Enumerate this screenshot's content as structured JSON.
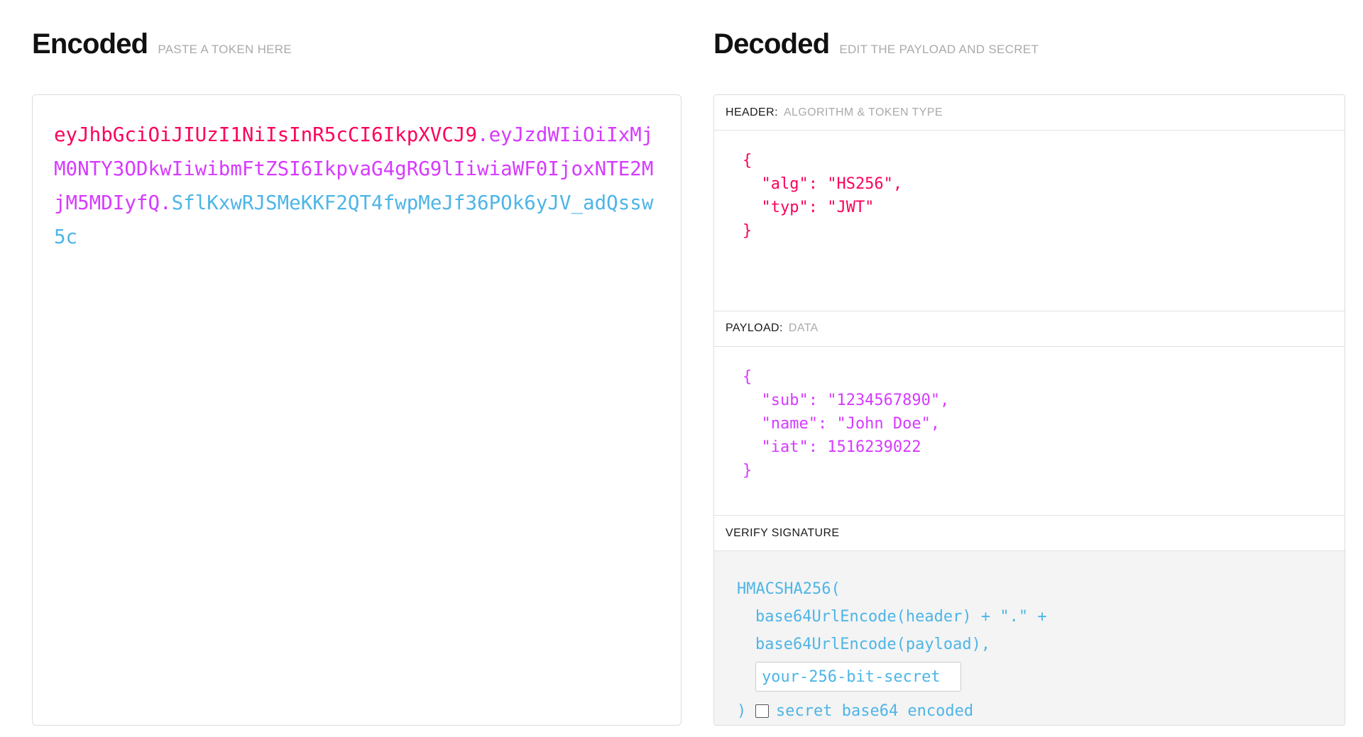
{
  "encoded": {
    "title": "Encoded",
    "subtitle": "PASTE A TOKEN HERE",
    "token": {
      "header_part": "eyJhbGciOiJIUzI1NiIsInR5cCI6IkpXVCJ9",
      "separator1": ".",
      "payload_part": "eyJzdWIiOiIxMjM0NTY3ODkwIiwibmFtZSI6IkpvaG4gRG9lIiwiaWF0IjoxNTE2MjM5MDIyfQ",
      "separator2": ".",
      "signature_part": "SflKxwRJSMeKKF2QT4fwpMeJf36POk6yJV_adQssw5c",
      "full": "eyJhbGciOiJIUzI1NiIsInR5cCI6IkpXVCJ9.eyJzdWIiOiIxMjM0NTY3ODkwIiwibmFtZSI6IkpvaG4gRG9lIiwiaWF0IjoxNTE2MjM5MDIyfQ.SflKxwRJSMeKKF2QT4fwpMeJf36POk6yJV_adQssw5c"
    },
    "colors": {
      "header": "#fb015b",
      "payload": "#d63aff",
      "signature": "#4eb5e6"
    }
  },
  "decoded": {
    "title": "Decoded",
    "subtitle": "EDIT THE PAYLOAD AND SECRET",
    "header_section": {
      "label": "HEADER:",
      "sublabel": "ALGORITHM & TOKEN TYPE",
      "json": "{\n  \"alg\": \"HS256\",\n  \"typ\": \"JWT\"\n}"
    },
    "payload_section": {
      "label": "PAYLOAD:",
      "sublabel": "DATA",
      "json": "{\n  \"sub\": \"1234567890\",\n  \"name\": \"John Doe\",\n  \"iat\": 1516239022\n}"
    },
    "signature_section": {
      "label": "VERIFY SIGNATURE",
      "line1": "HMACSHA256(",
      "line2": "base64UrlEncode(header) + \".\" +",
      "line3": "base64UrlEncode(payload),",
      "secret_value": "your-256-bit-secret",
      "secret_placeholder": "your-256-bit-secret",
      "closing_paren": ")",
      "checkbox_label": "secret base64 encoded",
      "checkbox_checked": false
    }
  }
}
